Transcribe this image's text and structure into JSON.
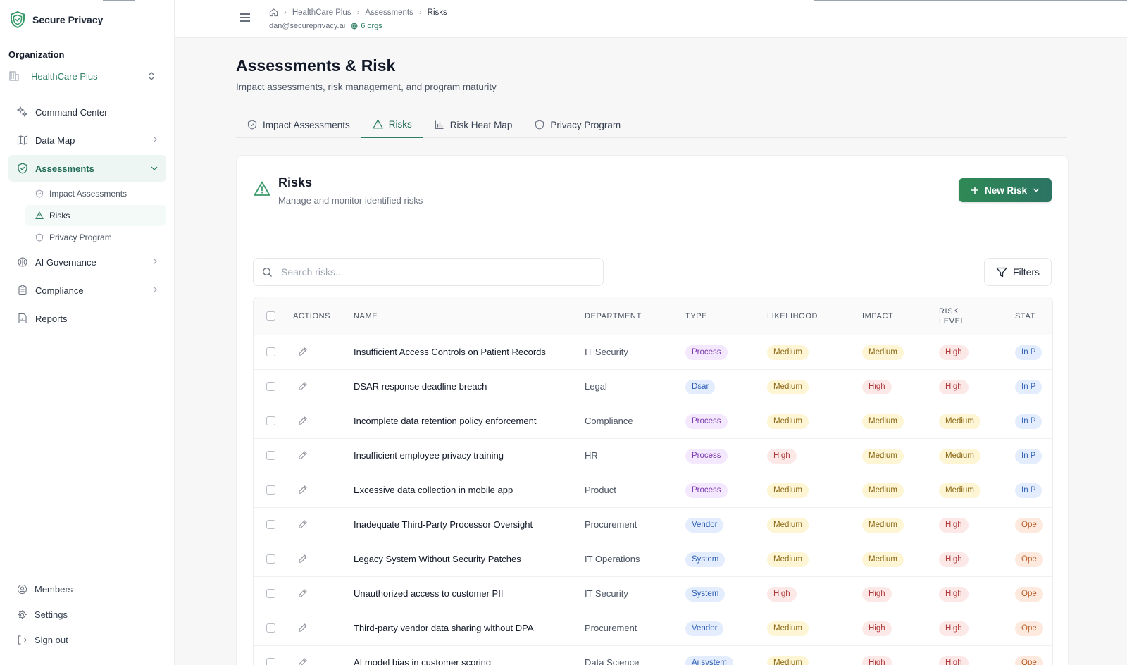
{
  "app": {
    "brand": "Secure Privacy",
    "brand_color": "#2d7d63"
  },
  "sidebar": {
    "org_label": "Organization",
    "org_name": "HealthCare Plus",
    "nav": {
      "command_center": "Command Center",
      "data_map": "Data Map",
      "assessments": "Assessments",
      "impact_assessments": "Impact Assessments",
      "risks": "Risks",
      "privacy_program": "Privacy Program",
      "ai_governance": "AI Governance",
      "compliance": "Compliance",
      "reports": "Reports"
    },
    "footer": {
      "members": "Members",
      "settings": "Settings",
      "sign_out": "Sign out"
    }
  },
  "topbar": {
    "breadcrumb": [
      "HealthCare Plus",
      "Assessments",
      "Risks"
    ],
    "user_email": "dan@secureprivacy.ai",
    "orgs_count": "6 orgs"
  },
  "page": {
    "title": "Assessments & Risk",
    "subtitle": "Impact assessments, risk management, and program maturity",
    "tabs": [
      "Impact Assessments",
      "Risks",
      "Risk Heat Map",
      "Privacy Program"
    ],
    "active_tab": "Risks"
  },
  "card": {
    "title": "Risks",
    "subtitle": "Manage and monitor identified risks",
    "new_button": "New Risk",
    "search_placeholder": "Search risks...",
    "filters_label": "Filters"
  },
  "table": {
    "headers": {
      "actions": "ACTIONS",
      "name": "NAME",
      "department": "DEPARTMENT",
      "type": "TYPE",
      "likelihood": "LIKELIHOOD",
      "impact": "IMPACT",
      "risk_level_1": "RISK",
      "risk_level_2": "LEVEL",
      "status": "STAT"
    },
    "rows": [
      {
        "name": "Insufficient Access Controls on Patient Records",
        "department": "IT Security",
        "type": "Process",
        "likelihood": "Medium",
        "impact": "Medium",
        "risk_level": "High",
        "status": "In P"
      },
      {
        "name": "DSAR response deadline breach",
        "department": "Legal",
        "type": "Dsar",
        "likelihood": "Medium",
        "impact": "High",
        "risk_level": "High",
        "status": "In P"
      },
      {
        "name": "Incomplete data retention policy enforcement",
        "department": "Compliance",
        "type": "Process",
        "likelihood": "Medium",
        "impact": "Medium",
        "risk_level": "Medium",
        "status": "In P"
      },
      {
        "name": "Insufficient employee privacy training",
        "department": "HR",
        "type": "Process",
        "likelihood": "High",
        "impact": "Medium",
        "risk_level": "Medium",
        "status": "In P"
      },
      {
        "name": "Excessive data collection in mobile app",
        "department": "Product",
        "type": "Process",
        "likelihood": "Medium",
        "impact": "Medium",
        "risk_level": "Medium",
        "status": "In P"
      },
      {
        "name": "Inadequate Third-Party Processor Oversight",
        "department": "Procurement",
        "type": "Vendor",
        "likelihood": "Medium",
        "impact": "Medium",
        "risk_level": "High",
        "status": "Ope"
      },
      {
        "name": "Legacy System Without Security Patches",
        "department": "IT Operations",
        "type": "System",
        "likelihood": "Medium",
        "impact": "Medium",
        "risk_level": "High",
        "status": "Ope"
      },
      {
        "name": "Unauthorized access to customer PII",
        "department": "IT Security",
        "type": "System",
        "likelihood": "High",
        "impact": "High",
        "risk_level": "High",
        "status": "Ope"
      },
      {
        "name": "Third-party vendor data sharing without DPA",
        "department": "Procurement",
        "type": "Vendor",
        "likelihood": "Medium",
        "impact": "High",
        "risk_level": "High",
        "status": "Ope"
      },
      {
        "name": "AI model bias in customer scoring",
        "department": "Data Science",
        "type": "Ai system",
        "likelihood": "Medium",
        "impact": "High",
        "risk_level": "High",
        "status": "Ope"
      }
    ]
  }
}
